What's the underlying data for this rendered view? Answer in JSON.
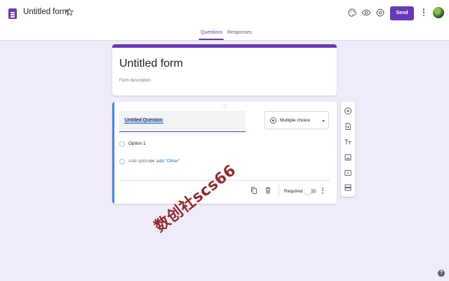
{
  "header": {
    "form_title": "Untitled form",
    "send_label": "Send",
    "icons": [
      "forms-logo-icon",
      "star-icon",
      "palette-icon",
      "preview-eye-icon",
      "settings-gear-icon",
      "more-vert-icon",
      "avatar"
    ]
  },
  "tabs": [
    {
      "label": "Questions",
      "active": true
    },
    {
      "label": "Responses",
      "active": false
    }
  ],
  "title_card": {
    "title": "Untitled form",
    "description_placeholder": "Form description"
  },
  "question": {
    "title": "Untitled Question",
    "type": "Multiple choice",
    "options": [
      "Option 1"
    ],
    "add_option": "Add option",
    "or": "or",
    "add_other": "add \"Other\"",
    "required_label": "Required",
    "required": false
  },
  "side_toolbar": [
    "add-question-icon",
    "import-questions-icon",
    "add-title-icon",
    "add-image-icon",
    "add-video-icon",
    "add-section-icon"
  ],
  "help": "?",
  "watermark": "数创社scs66",
  "colors": {
    "accent": "#673ab7",
    "background": "#f0ebf8",
    "focus_bar": "#4285f4",
    "link": "#1a73e8"
  }
}
